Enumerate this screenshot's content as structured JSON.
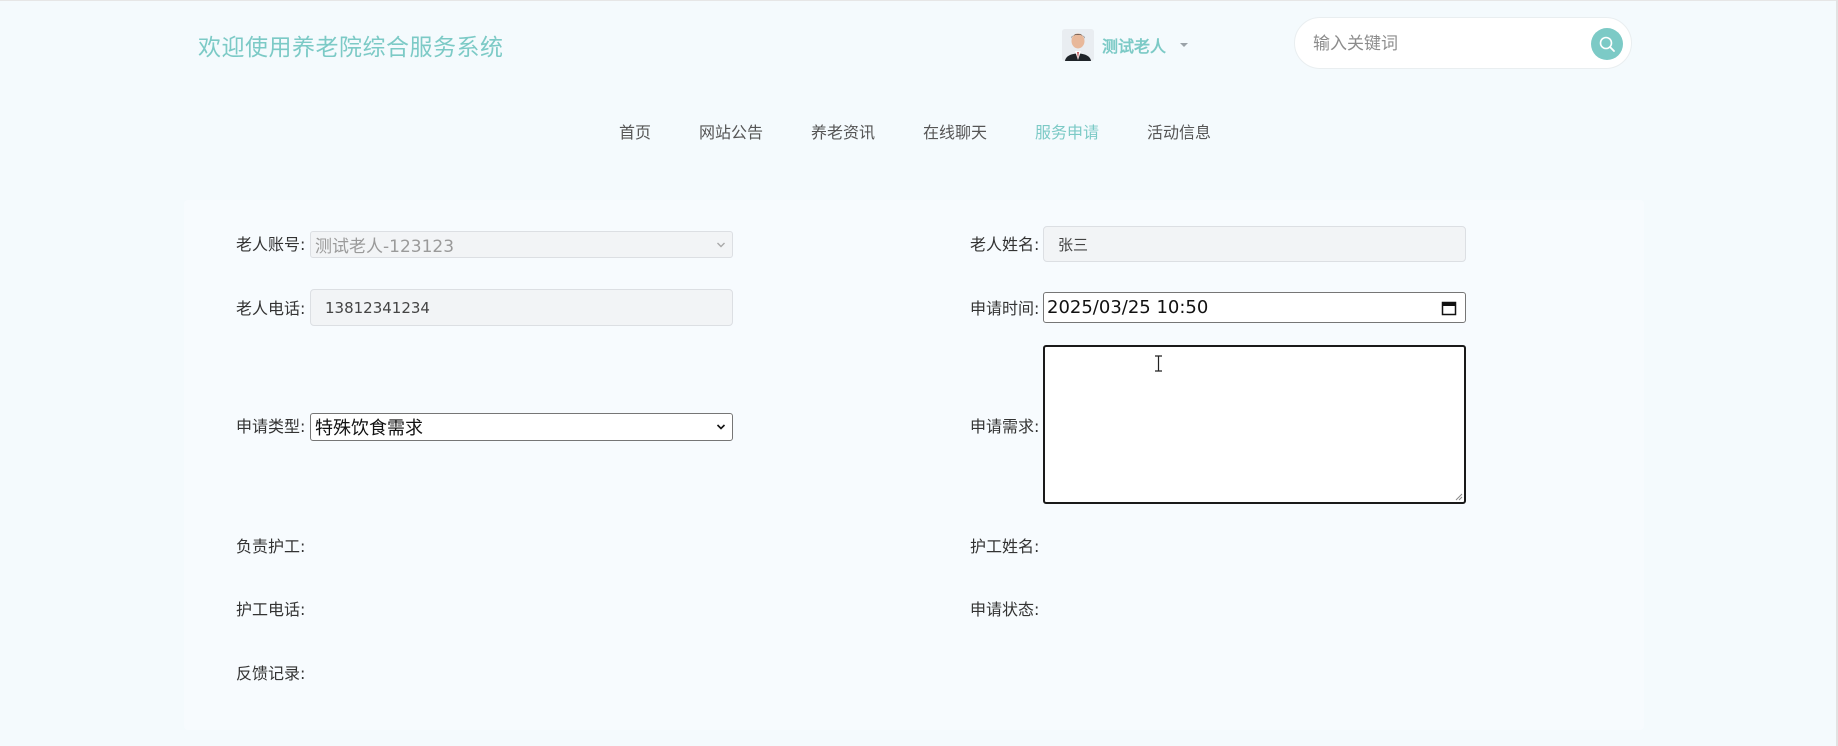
{
  "header": {
    "site_title": "欢迎使用养老院综合服务系统",
    "user_name": "测试老人",
    "search_placeholder": "输入关键词"
  },
  "nav": {
    "items": [
      {
        "label": "首页",
        "active": false
      },
      {
        "label": "网站公告",
        "active": false
      },
      {
        "label": "养老资讯",
        "active": false
      },
      {
        "label": "在线聊天",
        "active": false
      },
      {
        "label": "服务申请",
        "active": true
      },
      {
        "label": "活动信息",
        "active": false
      }
    ]
  },
  "form": {
    "elder_account": {
      "label": "老人账号:",
      "value": "测试老人-123123"
    },
    "elder_name": {
      "label": "老人姓名:",
      "value": "张三"
    },
    "elder_phone": {
      "label": "老人电话:",
      "value": "13812341234"
    },
    "apply_time": {
      "label": "申请时间:",
      "value": "2025/03/25 10:50"
    },
    "apply_type": {
      "label": "申请类型:",
      "value": "特殊饮食需求"
    },
    "apply_demand": {
      "label": "申请需求:",
      "value": ""
    },
    "nurse_in_charge": {
      "label": "负责护工:"
    },
    "nurse_name": {
      "label": "护工姓名:"
    },
    "nurse_phone": {
      "label": "护工电话:"
    },
    "apply_status": {
      "label": "申请状态:"
    },
    "feedback_record": {
      "label": "反馈记录:"
    }
  },
  "colors": {
    "accent": "#7ccac6",
    "page_bg": "#f4fafd"
  }
}
